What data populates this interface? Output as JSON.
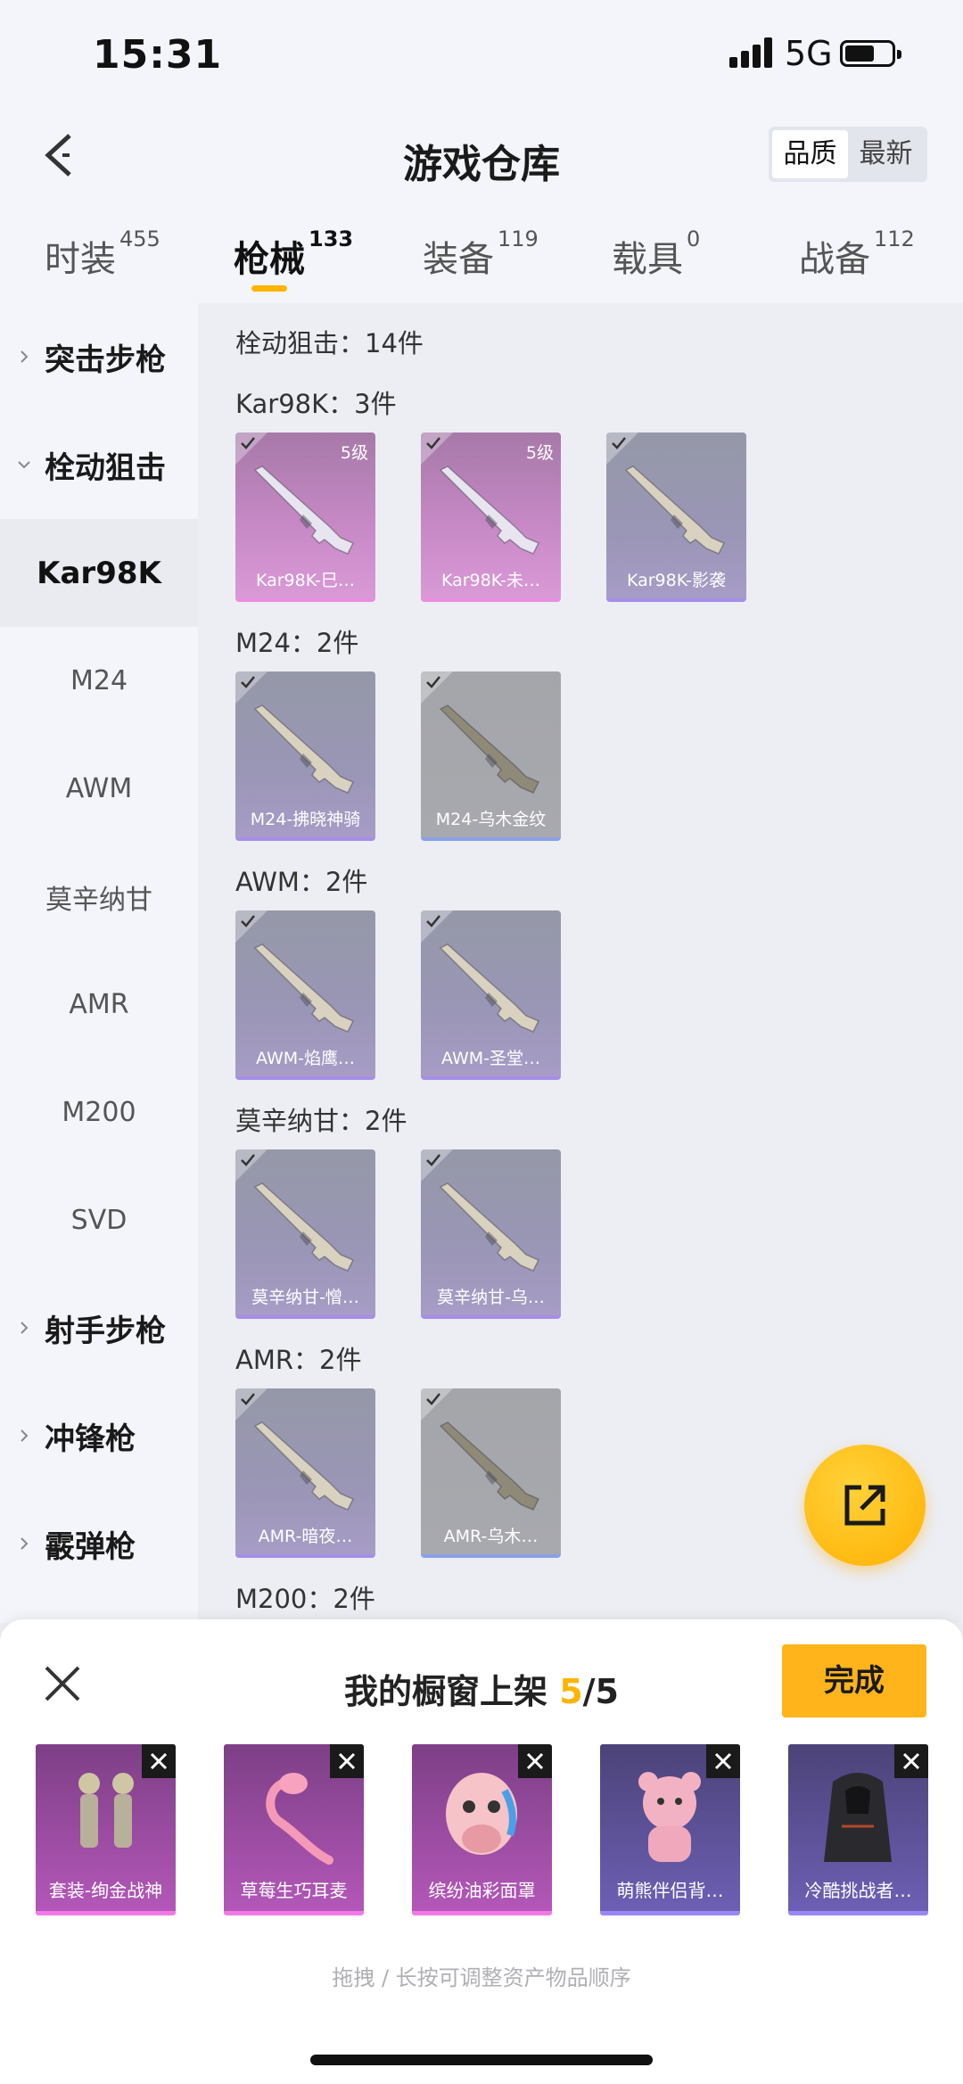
{
  "status": {
    "time": "15:31",
    "network": "5G"
  },
  "header": {
    "title": "游戏仓库",
    "sort_quality": "品质",
    "sort_newest": "最新"
  },
  "tabs": [
    {
      "label": "时装",
      "count": "455"
    },
    {
      "label": "枪械",
      "count": "133"
    },
    {
      "label": "装备",
      "count": "119"
    },
    {
      "label": "载具",
      "count": "0"
    },
    {
      "label": "战备",
      "count": "112"
    }
  ],
  "sidebar": {
    "groups": [
      "突击步枪",
      "栓动狙击",
      "射手步枪",
      "冲锋枪",
      "霰弹枪"
    ],
    "subs": [
      "Kar98K",
      "M24",
      "AWM",
      "莫辛纳甘",
      "AMR",
      "M200",
      "SVD"
    ]
  },
  "content": {
    "category_title": "栓动狙击：14件",
    "sections": [
      {
        "title": "Kar98K：3件",
        "items": [
          {
            "label": "Kar98K-巳…",
            "level": "5级",
            "rarity": "pink"
          },
          {
            "label": "Kar98K-未…",
            "level": "5级",
            "rarity": "pink"
          },
          {
            "label": "Kar98K-影袭",
            "level": "",
            "rarity": "purple"
          }
        ]
      },
      {
        "title": "M24：2件",
        "items": [
          {
            "label": "M24-拂晓神骑",
            "level": "",
            "rarity": "purple"
          },
          {
            "label": "M24-乌木金纹",
            "level": "",
            "rarity": "gray"
          }
        ]
      },
      {
        "title": "AWM：2件",
        "items": [
          {
            "label": "AWM-焰鹰…",
            "level": "",
            "rarity": "purple"
          },
          {
            "label": "AWM-圣堂…",
            "level": "",
            "rarity": "purple"
          }
        ]
      },
      {
        "title": "莫辛纳甘：2件",
        "items": [
          {
            "label": "莫辛纳甘-憎…",
            "level": "",
            "rarity": "purple"
          },
          {
            "label": "莫辛纳甘-乌…",
            "level": "",
            "rarity": "purple"
          }
        ]
      },
      {
        "title": "AMR：2件",
        "items": [
          {
            "label": "AMR-暗夜…",
            "level": "",
            "rarity": "purple"
          },
          {
            "label": "AMR-乌木…",
            "level": "",
            "rarity": "gray"
          }
        ]
      },
      {
        "title": "M200：2件",
        "items": []
      }
    ]
  },
  "showcase": {
    "title_prefix": "我的橱窗上架 ",
    "count": "5",
    "total": "/5",
    "done_label": "完成",
    "items": [
      {
        "label": "套装-绚金战神",
        "rarity": "pink"
      },
      {
        "label": "草莓生巧耳麦",
        "rarity": "pink"
      },
      {
        "label": "缤纷油彩面罩",
        "rarity": "pink"
      },
      {
        "label": "萌熊伴侣背…",
        "rarity": "blue"
      },
      {
        "label": "冷酷挑战者…",
        "rarity": "blue"
      }
    ],
    "hint": "拖拽 / 长按可调整资产物品顺序"
  },
  "colors": {
    "accent": "#ffb400"
  }
}
